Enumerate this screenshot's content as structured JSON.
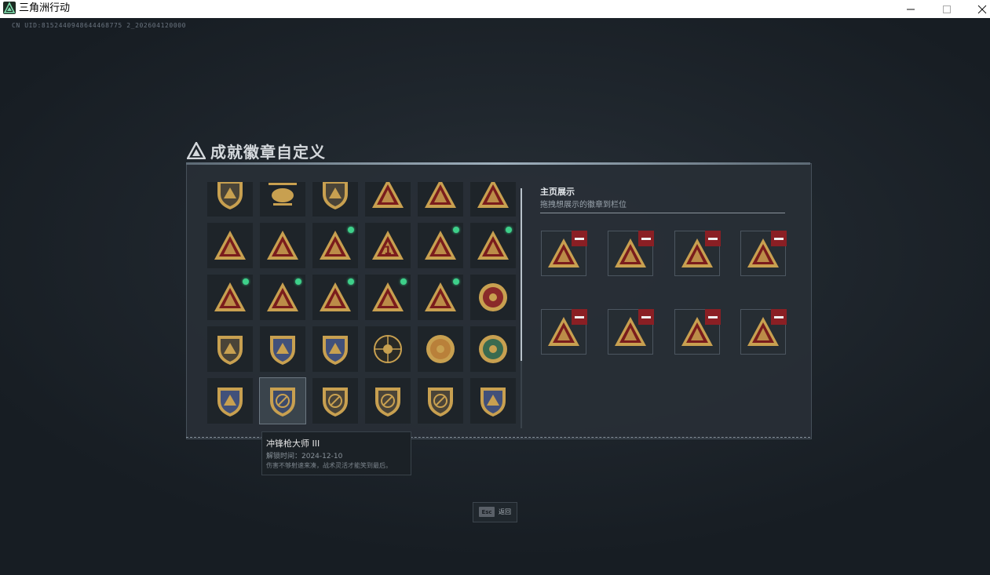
{
  "window": {
    "title": "三角洲行动"
  },
  "uid_text": "CN UID:8152440948644468775 2_202604120000",
  "panel": {
    "title": "成就徽章自定义",
    "showcase_title": "主页展示",
    "showcase_subtitle": "拖拽想展示的徽章到栏位"
  },
  "colors": {
    "gold": "#c8a050",
    "dark_red": "#7a1c1c",
    "new_dot": "#3ed08a",
    "remove_red": "#8a1f24"
  },
  "badges": [
    {
      "icon": "shield-emblem-icon",
      "new": false
    },
    {
      "icon": "helicopter-icon",
      "new": false
    },
    {
      "icon": "missile-shield-icon",
      "new": false
    },
    {
      "icon": "eye-triangle-icon",
      "new": false
    },
    {
      "icon": "lantern-triangle-icon",
      "new": false
    },
    {
      "icon": "truck-triangle-icon",
      "new": false
    },
    {
      "icon": "bottle-triangle-icon",
      "new": false
    },
    {
      "icon": "hand-triangle-icon",
      "new": false
    },
    {
      "icon": "soldier-triangle-icon",
      "new": true
    },
    {
      "icon": "number-one-triangle-icon",
      "new": false
    },
    {
      "icon": "bottle-triangle-icon",
      "new": true
    },
    {
      "icon": "canister-triangle-icon",
      "new": true
    },
    {
      "icon": "runner-triangle-icon",
      "new": true
    },
    {
      "icon": "mask-triangle-icon",
      "new": true
    },
    {
      "icon": "gunner-triangle-icon",
      "new": true
    },
    {
      "icon": "rocket-triangle-icon",
      "new": true
    },
    {
      "icon": "rifle-triangle-icon",
      "new": true
    },
    {
      "icon": "star-wreath-icon",
      "new": false
    },
    {
      "icon": "arrow-shield-icon",
      "new": false
    },
    {
      "icon": "eagle-shield-icon",
      "new": false
    },
    {
      "icon": "eagle-shield-red-icon",
      "new": false
    },
    {
      "icon": "skull-crosshair-icon",
      "new": false
    },
    {
      "icon": "face-laurel-icon",
      "new": false
    },
    {
      "icon": "crosshair-wings-icon",
      "new": false
    },
    {
      "icon": "crossed-rifles-shield-icon",
      "new": false
    },
    {
      "icon": "smg-circle-shield-icon",
      "new": false,
      "selected": true
    },
    {
      "icon": "no-symbol-shield-icon",
      "new": false
    },
    {
      "icon": "rifle-circle-shield-icon",
      "new": false
    },
    {
      "icon": "no-symbol-shield-icon",
      "new": false
    },
    {
      "icon": "crossed-rifles-shield-icon",
      "new": false
    }
  ],
  "showcase_slots": [
    {
      "icon": "soldier-triangle-icon"
    },
    {
      "icon": "runner-triangle-icon"
    },
    {
      "icon": "mask-triangle-icon"
    },
    {
      "icon": "rocket-triangle-icon"
    },
    {
      "icon": "bottle-triangle-icon"
    },
    {
      "icon": "hand-triangle-icon"
    },
    {
      "icon": "canister-triangle-icon"
    },
    {
      "icon": "rifle-triangle-icon"
    }
  ],
  "tooltip": {
    "name": "冲锋枪大师 III",
    "time": "解锁时间：2024-12-10",
    "desc": "伤害不够射速来凑，战术灵活才能笑到最后。"
  },
  "footer": {
    "esc_key": "Esc",
    "esc_label": "返回"
  }
}
